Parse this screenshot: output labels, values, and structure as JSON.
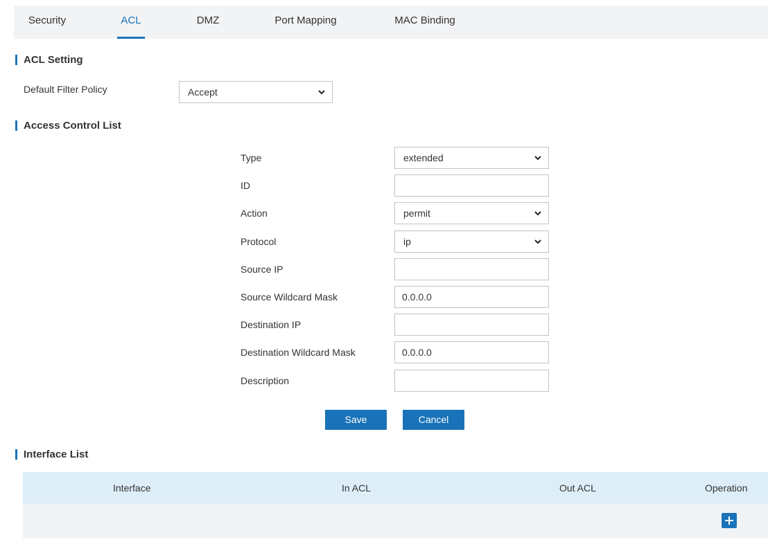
{
  "tabs": [
    {
      "label": "Security"
    },
    {
      "label": "ACL"
    },
    {
      "label": "DMZ"
    },
    {
      "label": "Port Mapping"
    },
    {
      "label": "MAC Binding"
    }
  ],
  "active_tab": "ACL",
  "acl_setting": {
    "title": "ACL Setting",
    "default_filter_policy_label": "Default Filter Policy",
    "default_filter_policy_value": "Accept"
  },
  "access_control_list": {
    "title": "Access Control List",
    "fields": {
      "type": {
        "label": "Type",
        "value": "extended"
      },
      "id": {
        "label": "ID",
        "value": ""
      },
      "action": {
        "label": "Action",
        "value": "permit"
      },
      "protocol": {
        "label": "Protocol",
        "value": "ip"
      },
      "source_ip": {
        "label": "Source IP",
        "value": ""
      },
      "source_wildcard_mask": {
        "label": "Source Wildcard Mask",
        "value": "0.0.0.0"
      },
      "destination_ip": {
        "label": "Destination IP",
        "value": ""
      },
      "destination_wildcard_mask": {
        "label": "Destination Wildcard Mask",
        "value": "0.0.0.0"
      },
      "description": {
        "label": "Description",
        "value": ""
      }
    },
    "save_label": "Save",
    "cancel_label": "Cancel"
  },
  "interface_list": {
    "title": "Interface List",
    "columns": [
      "Interface",
      "In ACL",
      "Out ACL",
      "Operation"
    ],
    "add_icon": "plus-icon"
  },
  "colors": {
    "accent": "#1a73b8",
    "tab_bar_bg": "#f1f3f5",
    "table_header_bg": "#ddeef8"
  }
}
